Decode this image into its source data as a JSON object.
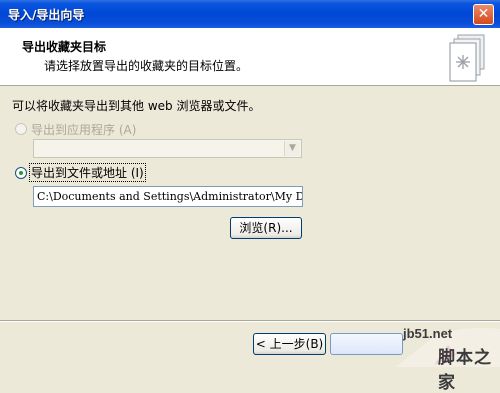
{
  "window": {
    "title": "导入/导出向导",
    "close_symbol": "✕"
  },
  "header": {
    "title": "导出收藏夹目标",
    "subtitle": "请选择放置导出的收藏夹的目标位置。"
  },
  "intro_text": "可以将收藏夹导出到其他 web 浏览器或文件。",
  "options": {
    "export_to_app": {
      "label": "导出到应用程序 (A)",
      "checked": false,
      "enabled": false
    },
    "app_select": {
      "value": "",
      "enabled": false
    },
    "export_to_file": {
      "label": "导出到文件或地址 (I)",
      "checked": true,
      "enabled": true
    },
    "file_path": {
      "value": "C:\\Documents and Settings\\Administrator\\My D"
    },
    "browse_label": "浏览(R)..."
  },
  "footer": {
    "back_label": "< 上一步(B)"
  },
  "watermark": {
    "site": "jb51.net",
    "name": "脚本之家"
  },
  "colors": {
    "titlebar": "#0047d6",
    "face": "#ece9d8",
    "radio_dot": "#21a121"
  }
}
